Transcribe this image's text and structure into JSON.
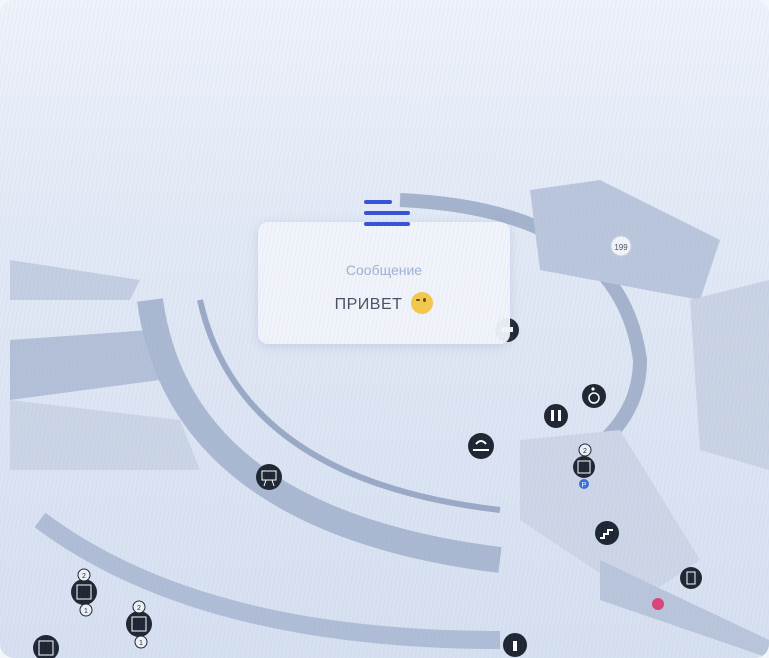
{
  "message": {
    "title": "Сообщение",
    "text": "ПРИВЕТ",
    "emoji": "wink-emoji"
  },
  "map_badges": {
    "room_number": "199",
    "floor_badge_1": "2",
    "floor_badge_2": "1",
    "floor_badge_3": "2",
    "floor_badge_4": "1",
    "elevator_badge_top": "2",
    "elevator_badge_bottom": "P"
  },
  "icons": [
    "menu-icon",
    "elevator-icon",
    "restroom-icon",
    "wheelchair-icon",
    "cloakroom-icon",
    "presentation-icon",
    "stairs-icon",
    "door-icon",
    "info-icon",
    "location-pin"
  ],
  "colors": {
    "accent": "#3653d8",
    "map_dark": "#1f2633",
    "pin": "#d9457a"
  }
}
